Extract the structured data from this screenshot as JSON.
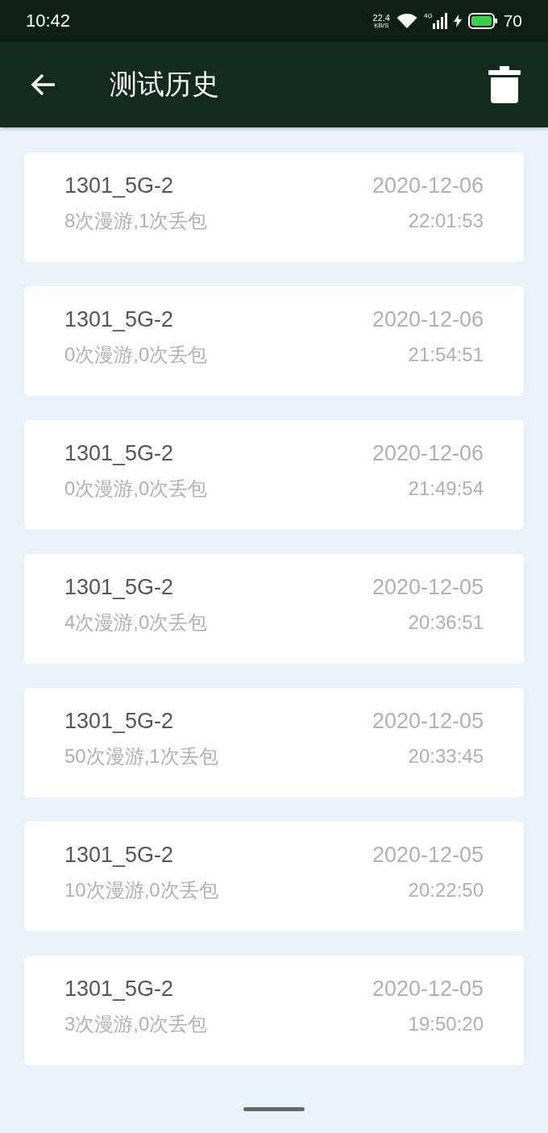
{
  "status_bar": {
    "time": "10:42",
    "net_speed": "22.4",
    "net_unit": "KB/S",
    "network_type": "4G",
    "battery": "70"
  },
  "app_bar": {
    "title": "测试历史"
  },
  "records": [
    {
      "name": "1301_5G-2",
      "summary": "8次漫游,1次丢包",
      "date": "2020-12-06",
      "time": "22:01:53"
    },
    {
      "name": "1301_5G-2",
      "summary": "0次漫游,0次丢包",
      "date": "2020-12-06",
      "time": "21:54:51"
    },
    {
      "name": "1301_5G-2",
      "summary": "0次漫游,0次丢包",
      "date": "2020-12-06",
      "time": "21:49:54"
    },
    {
      "name": "1301_5G-2",
      "summary": "4次漫游,0次丢包",
      "date": "2020-12-05",
      "time": "20:36:51"
    },
    {
      "name": "1301_5G-2",
      "summary": "50次漫游,1次丢包",
      "date": "2020-12-05",
      "time": "20:33:45"
    },
    {
      "name": "1301_5G-2",
      "summary": "10次漫游,0次丢包",
      "date": "2020-12-05",
      "time": "20:22:50"
    },
    {
      "name": "1301_5G-2",
      "summary": "3次漫游,0次丢包",
      "date": "2020-12-05",
      "time": "19:50:20"
    }
  ]
}
